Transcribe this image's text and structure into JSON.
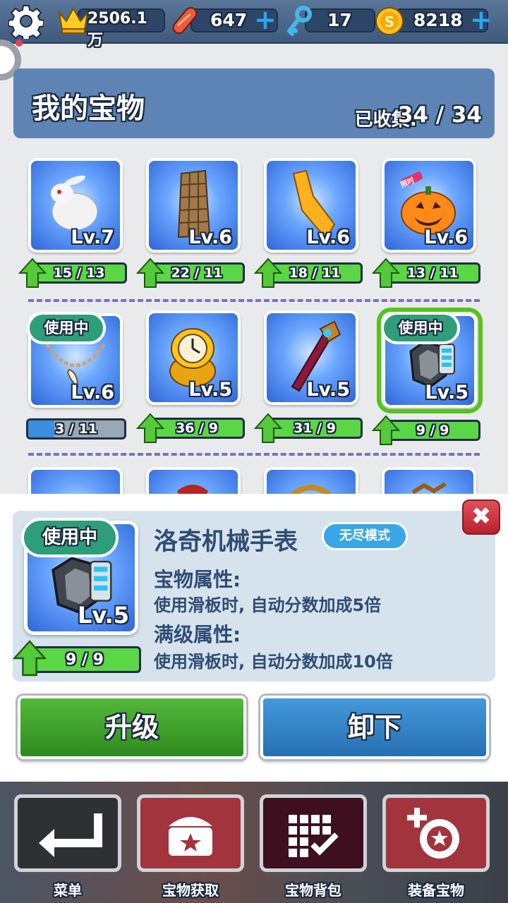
{
  "topbar": {
    "crown_value": "2506.1万",
    "skateboard_value": "647",
    "key_value": "17",
    "coin_value": "8218",
    "plus": "+"
  },
  "header": {
    "title": "我的宝物",
    "collected_label": "已收集:",
    "collected_value": "34 / 34"
  },
  "treasures": [
    {
      "level": "Lv.7",
      "progress": "15 / 13",
      "art": "rabbit"
    },
    {
      "level": "Lv.6",
      "progress": "22 / 11",
      "art": "building"
    },
    {
      "level": "Lv.6",
      "progress": "18 / 11",
      "art": "board"
    },
    {
      "level": "Lv.6",
      "progress": "13 / 11",
      "art": "pumpkin",
      "tag": "限时"
    },
    {
      "level": "Lv.6",
      "progress": "3 / 11",
      "art": "necklace",
      "in_use": "使用中",
      "fill": 0.27
    },
    {
      "level": "Lv.5",
      "progress": "36 / 9",
      "art": "ring"
    },
    {
      "level": "Lv.5",
      "progress": "31 / 9",
      "art": "wand"
    },
    {
      "level": "Lv.5",
      "progress": "9 / 9",
      "art": "watch",
      "in_use": "使用中",
      "selected": true
    }
  ],
  "detail": {
    "in_use": "使用中",
    "level": "Lv.5",
    "progress": "9 / 9",
    "name": "洛奇机械手表",
    "mode": "无尽模式",
    "attr_label": "宝物属性:",
    "attr_text": "使用滑板时, 自动分数加成5倍",
    "max_label": "满级属性:",
    "max_text": "使用滑板时, 自动分数加成10倍",
    "close": "✖"
  },
  "actions": {
    "upgrade": "升级",
    "unequip": "卸下"
  },
  "nav": [
    {
      "label": "菜单",
      "icon": "return-icon"
    },
    {
      "label": "宝物获取",
      "icon": "chest-icon"
    },
    {
      "label": "宝物背包",
      "icon": "grid-check-icon"
    },
    {
      "label": "装备宝物",
      "icon": "equip-icon"
    }
  ],
  "colors": {
    "green": "#54b83b",
    "blue": "#4399d9",
    "selected_outline": "#56c21b"
  }
}
